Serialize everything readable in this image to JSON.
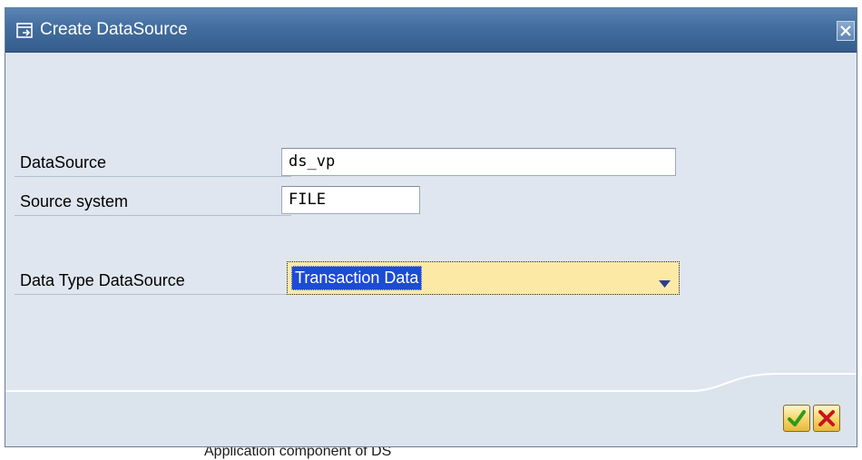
{
  "dialog": {
    "title": "Create DataSource",
    "icons": {
      "title": "create-document-icon",
      "close": "close-icon",
      "confirm": "checkmark-icon",
      "cancel": "cancel-x-icon",
      "dropdown": "dropdown-arrow-icon"
    }
  },
  "form": {
    "datasource": {
      "label": "DataSource",
      "value": "ds_vp"
    },
    "source_system": {
      "label": "Source system",
      "value": "FILE"
    },
    "data_type": {
      "label": "Data Type DataSource",
      "selected": "Transaction Data"
    }
  },
  "background": {
    "partial_text": "Application component of DS"
  },
  "colors": {
    "title_bar": "#426d9e",
    "dialog_bg": "#dfe6ef",
    "dropdown_bg": "#fde9a6",
    "selection": "#1c4bd6",
    "confirm_green": "#2e9a1a",
    "cancel_red": "#c8141c"
  }
}
